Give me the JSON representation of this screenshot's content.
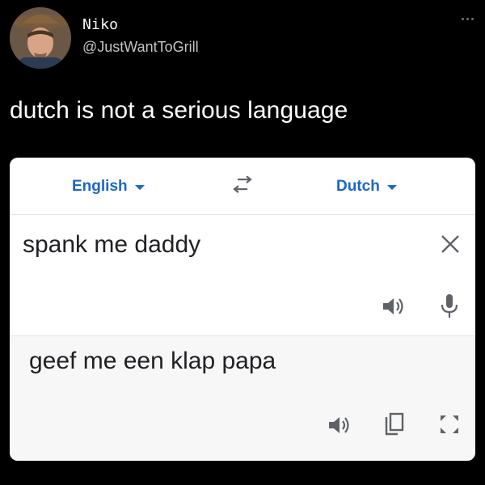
{
  "tweet": {
    "display_name": "Niko",
    "handle": "@JustWantToGrill",
    "text": "dutch is not a serious language",
    "avatar_icon": "user-avatar-photo",
    "more_icon": "more-horizontal-icon"
  },
  "translate": {
    "source_language": "English",
    "target_language": "Dutch",
    "source_text": "spank me daddy",
    "translated_text": "geef me een klap papa",
    "icons": {
      "swap": "swap-languages-icon",
      "clear": "close-icon",
      "speaker": "speaker-icon",
      "mic": "microphone-icon",
      "copy": "copy-icon",
      "fullscreen": "fullscreen-icon"
    }
  },
  "colors": {
    "background": "#000000",
    "accent": "#1a66c9",
    "icon_gray": "#5f6368"
  }
}
